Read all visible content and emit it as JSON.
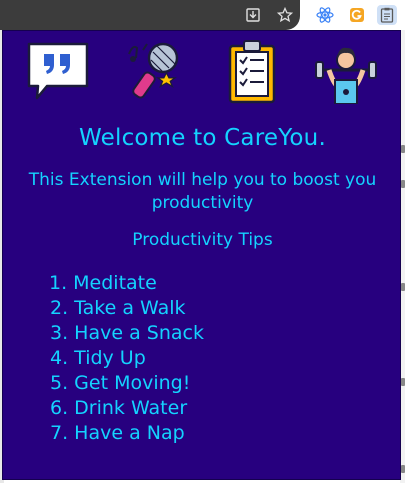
{
  "browser": {
    "toolbar_icons": [
      "download-icon",
      "bookmark-star-icon",
      "react-devtools-icon",
      "grammarly-icon",
      "careyou-extension-icon"
    ]
  },
  "popup": {
    "icons": [
      "quote-speech-bubble-icon",
      "microphone-icon",
      "checklist-clipboard-icon",
      "weightlifter-icon"
    ],
    "welcome": "Welcome to CareYou.",
    "intro": "This Extension will help you to boost you productivity",
    "tips_heading": "Productivity Tips",
    "tips": [
      "1. Meditate",
      "2. Take a Walk",
      "3. Have a Snack",
      "4. Tidy Up",
      "5. Get Moving!",
      "6. Drink Water",
      "7. Have a Nap"
    ]
  },
  "colors": {
    "popup_background": "#27007f",
    "text": "#14d3ff"
  }
}
